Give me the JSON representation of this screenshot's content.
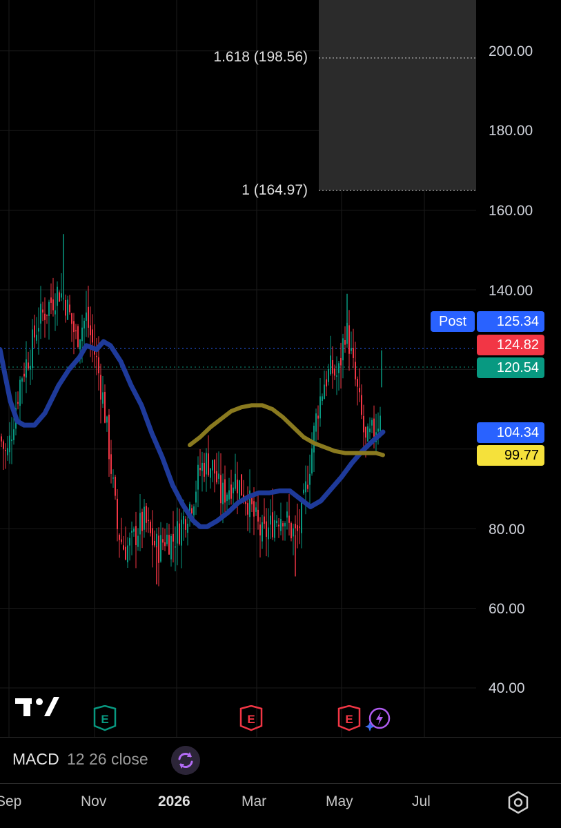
{
  "chart_data": {
    "type": "candlestick",
    "y_axis": {
      "ticks": [
        "200.00",
        "180.00",
        "160.00",
        "140.00",
        "80.00",
        "60.00",
        "40.00"
      ],
      "ylim": [
        34,
        220
      ]
    },
    "x_axis": {
      "ticks": [
        "Sep",
        "Nov",
        "2026",
        "Mar",
        "May",
        "Jul"
      ]
    },
    "fib_levels": [
      {
        "label": "1.618 (198.56)",
        "value": 198.56
      },
      {
        "label": "1 (164.97)",
        "value": 164.97
      }
    ],
    "price_tags": {
      "post_label": "Post",
      "post": {
        "text": "125.34",
        "value": 125.34,
        "color": "#2962ff"
      },
      "last": {
        "text": "124.82",
        "value": 124.82,
        "color": "#f23645"
      },
      "close": {
        "text": "120.54",
        "value": 120.54,
        "color": "#089981"
      },
      "ma_blue": {
        "text": "104.34",
        "value": 104.34,
        "color": "#2962ff"
      },
      "ma_yellow": {
        "text": "99.77",
        "value": 99.77,
        "color": "#f5e13b"
      }
    },
    "ma_fast": [
      [
        0,
        125
      ],
      [
        8,
        118
      ],
      [
        15,
        112
      ],
      [
        25,
        107
      ],
      [
        35,
        106
      ],
      [
        50,
        106
      ],
      [
        65,
        109
      ],
      [
        85,
        116
      ],
      [
        100,
        120
      ],
      [
        115,
        123
      ],
      [
        125,
        126
      ],
      [
        140,
        125
      ],
      [
        150,
        127
      ],
      [
        160,
        126
      ],
      [
        175,
        122
      ],
      [
        190,
        116
      ],
      [
        205,
        111
      ],
      [
        220,
        104
      ],
      [
        235,
        98
      ],
      [
        250,
        91
      ],
      [
        265,
        86
      ],
      [
        280,
        82
      ],
      [
        290,
        80.5
      ],
      [
        300,
        80.5
      ],
      [
        315,
        82
      ],
      [
        330,
        84
      ],
      [
        345,
        86.5
      ],
      [
        360,
        88
      ],
      [
        375,
        89
      ],
      [
        390,
        89
      ],
      [
        405,
        89.5
      ],
      [
        420,
        89.5
      ],
      [
        435,
        87.5
      ],
      [
        450,
        85.5
      ],
      [
        465,
        87
      ],
      [
        480,
        90
      ],
      [
        495,
        93
      ],
      [
        510,
        96.5
      ],
      [
        525,
        99.5
      ],
      [
        540,
        102
      ],
      [
        555,
        104.3
      ]
    ],
    "ma_slow": [
      [
        275,
        101
      ],
      [
        290,
        103
      ],
      [
        305,
        105.5
      ],
      [
        320,
        107.5
      ],
      [
        335,
        109.5
      ],
      [
        350,
        110.5
      ],
      [
        365,
        111
      ],
      [
        380,
        111
      ],
      [
        395,
        110
      ],
      [
        410,
        108
      ],
      [
        425,
        105.5
      ],
      [
        440,
        103
      ],
      [
        455,
        101.5
      ],
      [
        470,
        100.5
      ],
      [
        485,
        99.5
      ],
      [
        500,
        99
      ],
      [
        515,
        99
      ],
      [
        530,
        99
      ],
      [
        545,
        99
      ],
      [
        555,
        98.5
      ]
    ]
  },
  "macd": {
    "name": "MACD",
    "params": "12 26 close"
  },
  "colors": {
    "up": "#089981",
    "down": "#f23645",
    "ma_fast": "#1e3a9a",
    "ma_slow": "#8a7a1f",
    "background": "#000000"
  },
  "icons": [
    "tradingview-logo",
    "earnings-icon",
    "bolt-sparkle-icon",
    "refresh-icon",
    "settings-icon"
  ],
  "earnings_markers": [
    "E",
    "E",
    "E"
  ]
}
